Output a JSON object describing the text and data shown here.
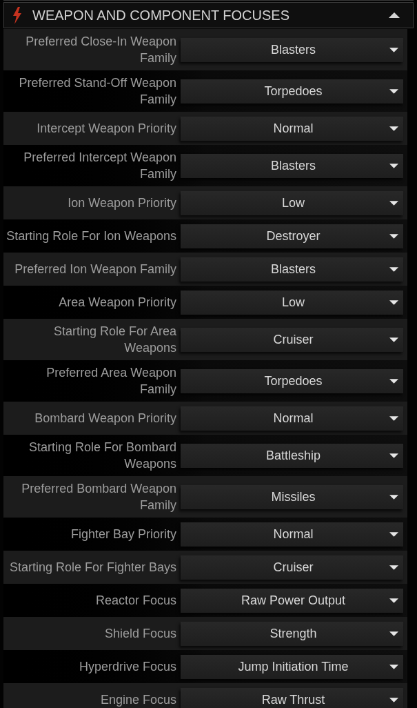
{
  "header": {
    "title": "WEAPON AND COMPONENT FOCUSES",
    "expanded": true
  },
  "rows": [
    {
      "label": "Preferred Close-In Weapon\nFamily",
      "value": "Blasters"
    },
    {
      "label": "Preferred Stand-Off Weapon\nFamily",
      "value": "Torpedoes"
    },
    {
      "label": "Intercept Weapon Priority",
      "value": "Normal"
    },
    {
      "label": "Preferred Intercept Weapon\nFamily",
      "value": "Blasters"
    },
    {
      "label": "Ion Weapon Priority",
      "value": "Low"
    },
    {
      "label": "Starting Role For Ion Weapons",
      "value": "Destroyer"
    },
    {
      "label": "Preferred Ion Weapon Family",
      "value": "Blasters"
    },
    {
      "label": "Area Weapon Priority",
      "value": "Low"
    },
    {
      "label": "Starting Role For Area\nWeapons",
      "value": "Cruiser"
    },
    {
      "label": "Preferred Area Weapon\nFamily",
      "value": "Torpedoes"
    },
    {
      "label": "Bombard Weapon Priority",
      "value": "Normal"
    },
    {
      "label": "Starting Role For Bombard\nWeapons",
      "value": "Battleship"
    },
    {
      "label": "Preferred Bombard Weapon\nFamily",
      "value": "Missiles"
    },
    {
      "label": "Fighter Bay Priority",
      "value": "Normal"
    },
    {
      "label": "Starting Role For Fighter Bays",
      "value": "Cruiser"
    },
    {
      "label": "Reactor Focus",
      "value": "Raw Power Output"
    },
    {
      "label": "Shield Focus",
      "value": "Strength"
    },
    {
      "label": "Hyperdrive Focus",
      "value": "Jump Initiation Time"
    },
    {
      "label": "Engine Focus",
      "value": "Raw Thrust"
    }
  ]
}
